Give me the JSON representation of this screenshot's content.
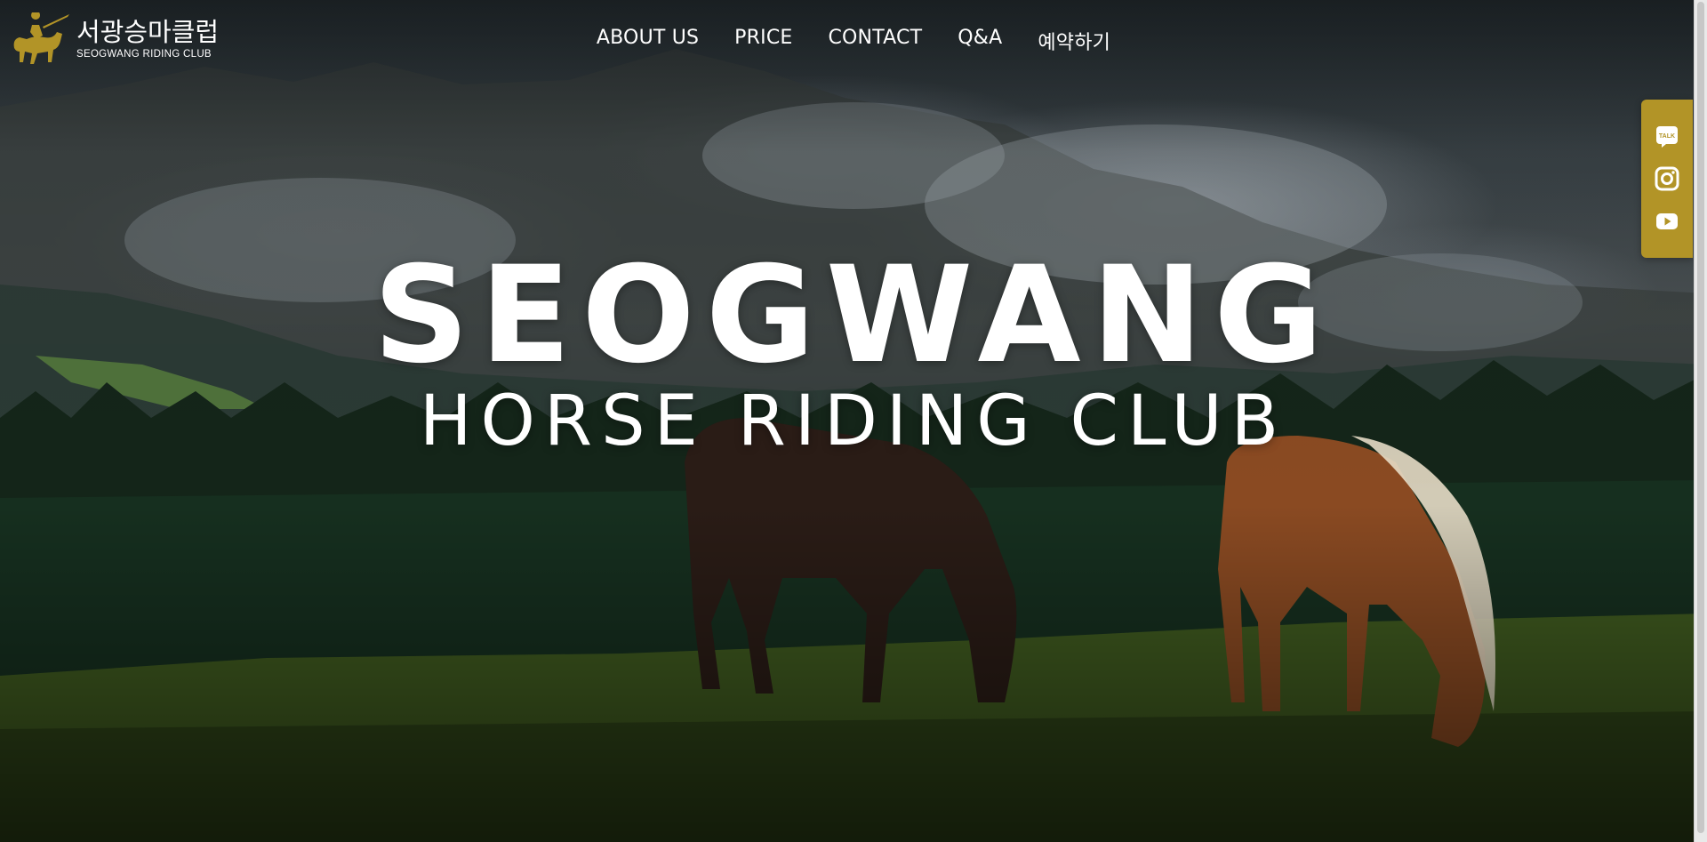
{
  "brand": {
    "name_kr": "서광승마클럽",
    "name_en": "SEOGWANG RIDING CLUB",
    "logo_icon": "horse-rider-icon",
    "gold": "#b29427"
  },
  "nav": {
    "items": [
      {
        "label": "ABOUT US"
      },
      {
        "label": "PRICE"
      },
      {
        "label": "CONTACT"
      },
      {
        "label": "Q&A"
      },
      {
        "label": "예약하기"
      }
    ]
  },
  "hero": {
    "title": "SEOGWANG",
    "subtitle": "HORSE RIDING CLUB"
  },
  "social": {
    "items": [
      {
        "icon": "kakaotalk-icon",
        "label": "TALK"
      },
      {
        "icon": "instagram-icon"
      },
      {
        "icon": "youtube-icon"
      }
    ]
  }
}
